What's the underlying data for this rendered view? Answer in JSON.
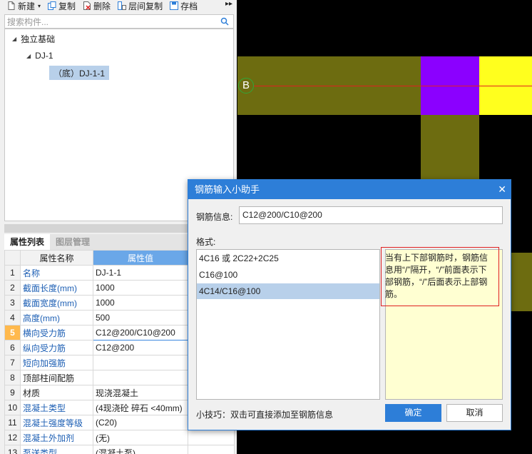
{
  "toolbar": {
    "new_label": "新建",
    "copy_label": "复制",
    "delete_label": "删除",
    "layer_copy_label": "层间复制",
    "save_label": "存档",
    "more_icon": "double-chevron-right"
  },
  "search": {
    "placeholder": "搜索构件..."
  },
  "tree": {
    "root": "独立基础",
    "child": "DJ-1",
    "leaf": "（底）DJ-1-1"
  },
  "tabs": {
    "props": "属性列表",
    "layers": "图层管理"
  },
  "props": {
    "header_name": "属性名称",
    "header_value": "属性值",
    "rows": [
      {
        "no": "1",
        "name": "名称",
        "value": "DJ-1-1"
      },
      {
        "no": "2",
        "name": "截面长度(mm)",
        "value": "1000"
      },
      {
        "no": "3",
        "name": "截面宽度(mm)",
        "value": "1000"
      },
      {
        "no": "4",
        "name": "高度(mm)",
        "value": "500"
      },
      {
        "no": "5",
        "name": "横向受力筋",
        "value": "C12@200/C10@200"
      },
      {
        "no": "6",
        "name": "纵向受力筋",
        "value": "C12@200"
      },
      {
        "no": "7",
        "name": "短向加强筋",
        "value": ""
      },
      {
        "no": "8",
        "name": "顶部柱间配筋",
        "value": ""
      },
      {
        "no": "9",
        "name": "材质",
        "value": "现浇混凝土"
      },
      {
        "no": "10",
        "name": "混凝土类型",
        "value": "(4现浇砼 碎石 <40mm)"
      },
      {
        "no": "11",
        "name": "混凝土强度等级",
        "value": "(C20)"
      },
      {
        "no": "12",
        "name": "混凝土外加剂",
        "value": "(无)"
      },
      {
        "no": "13",
        "name": "泵送类型",
        "value": "(混凝土泵)"
      }
    ]
  },
  "canvas": {
    "axis_label": "B"
  },
  "dialog": {
    "title": "钢筋输入小助手",
    "info_label": "钢筋信息:",
    "info_value": "C12@200/C10@200",
    "format_label": "格式:",
    "formats": [
      "4C16 或 2C22+2C25",
      "C16@100",
      "4C14/C16@100"
    ],
    "hint": "当有上下部钢筋时，钢筋信息用“/”隔开，“/”前面表示下部钢筋，“/”后面表示上部钢筋。",
    "tip": "小技巧：双击可直接添加至钢筋信息",
    "ok_label": "确定",
    "cancel_label": "取消"
  },
  "colors": {
    "olive": "#6d6c10",
    "purple": "#8b00ff",
    "yellow": "#ffff1e",
    "accent": "#2d7ed8"
  }
}
